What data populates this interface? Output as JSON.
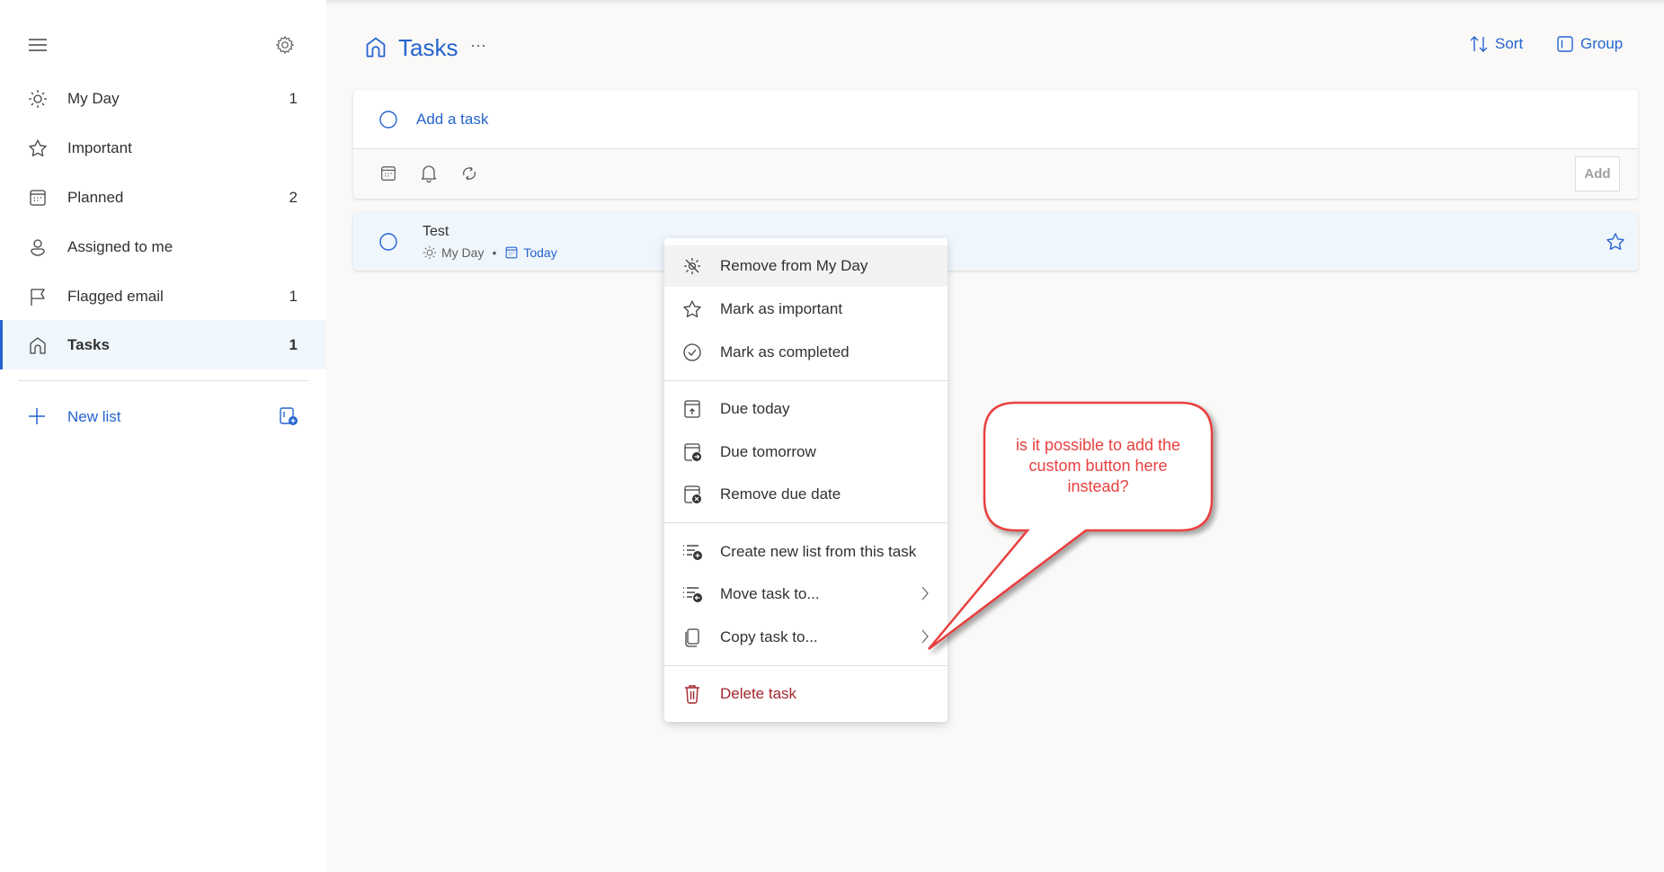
{
  "sidebar": {
    "items": [
      {
        "label": "My Day",
        "count": "1",
        "icon": "sun-icon"
      },
      {
        "label": "Important",
        "count": "",
        "icon": "star-icon"
      },
      {
        "label": "Planned",
        "count": "2",
        "icon": "calendar-icon"
      },
      {
        "label": "Assigned to me",
        "count": "",
        "icon": "person-icon"
      },
      {
        "label": "Flagged email",
        "count": "1",
        "icon": "flag-icon"
      },
      {
        "label": "Tasks",
        "count": "1",
        "icon": "home-icon",
        "selected": true
      }
    ],
    "new_list": "New list"
  },
  "header": {
    "title": "Tasks",
    "more": "···",
    "sort": "Sort",
    "group": "Group"
  },
  "add_task": {
    "placeholder": "Add a task",
    "add_button": "Add"
  },
  "tasks": [
    {
      "title": "Test",
      "myday": "My Day",
      "separator": "•",
      "due": "Today",
      "important": false
    }
  ],
  "context_menu": {
    "items": [
      {
        "label": "Remove from My Day",
        "icon": "sun-off-icon"
      },
      {
        "label": "Mark as important",
        "icon": "star-icon"
      },
      {
        "label": "Mark as completed",
        "icon": "check-circle-icon"
      },
      {
        "label": "Due today",
        "icon": "calendar-today-icon"
      },
      {
        "label": "Due tomorrow",
        "icon": "calendar-arrow-icon"
      },
      {
        "label": "Remove due date",
        "icon": "calendar-remove-icon"
      },
      {
        "label": "Create new list from this task",
        "icon": "list-add-icon"
      },
      {
        "label": "Move task to...",
        "icon": "list-move-icon"
      },
      {
        "label": "Copy task to...",
        "icon": "copy-icon"
      },
      {
        "label": "Delete task",
        "icon": "trash-icon"
      }
    ]
  },
  "annotation": {
    "text": "is it possible to add the custom button here instead?"
  },
  "colors": {
    "accent": "#2564cf",
    "danger": "#a4262c",
    "annotation": "#e8413f",
    "selected_bg": "#eff6fc"
  }
}
